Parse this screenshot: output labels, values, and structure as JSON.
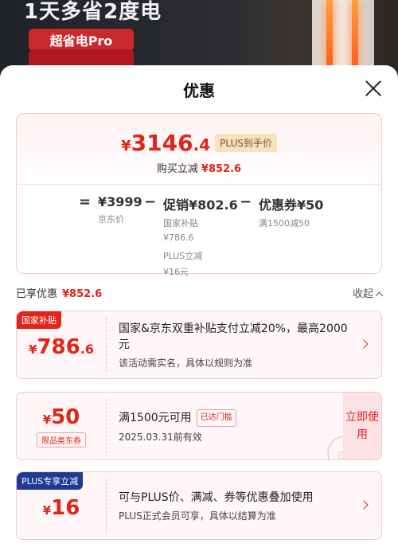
{
  "banner": {
    "title": "1天多省2度电",
    "pill": "超省电Pro"
  },
  "sheet": {
    "title": "优惠"
  },
  "price_box": {
    "currency": "¥",
    "price_int": "3146",
    "price_dec": ".4",
    "plus_tag": "PLUS到手价",
    "sub_label": "购买立减",
    "sub_value": "¥852.6",
    "formula": {
      "eq": "=",
      "minus": "−",
      "jd_price": "¥3999",
      "jd_label": "京东价",
      "promo_value": "促销¥802.6",
      "promo_sub1_label": "国家补贴",
      "promo_sub1_value": "¥786.6",
      "promo_sub2_label": "PLUS立减",
      "promo_sub2_value": "¥16元",
      "coupon_value": "优惠券¥50",
      "coupon_label": "满1500减50"
    }
  },
  "enjoyed": {
    "label": "已享优惠",
    "value": "¥852.6",
    "collapse": "收起"
  },
  "coupons": [
    {
      "tag": "国家补贴",
      "yen": "¥",
      "amount": "786",
      "decimal": ".6",
      "text1": "国家&京东双重补贴支付立减20%，最高2000元",
      "text2": "该活动需实名，具体以规则为准"
    },
    {
      "yen": "¥",
      "amount": "50",
      "small_box": "限品类东券",
      "text1": "满1500元可用",
      "reach": "已达门槛",
      "text2": "2025.03.31前有效",
      "use_now": "立即使用",
      "stamp": "已选"
    },
    {
      "tag": "PLUS专享立减",
      "yen": "¥",
      "amount": "16",
      "text1": "可与PLUS价、满减、券等优惠叠加使用",
      "text2": "PLUS正式会员可享，具体以结算为准"
    }
  ],
  "colors": {
    "accent": "#e1251b",
    "plus_blue": "#1e3a96"
  }
}
